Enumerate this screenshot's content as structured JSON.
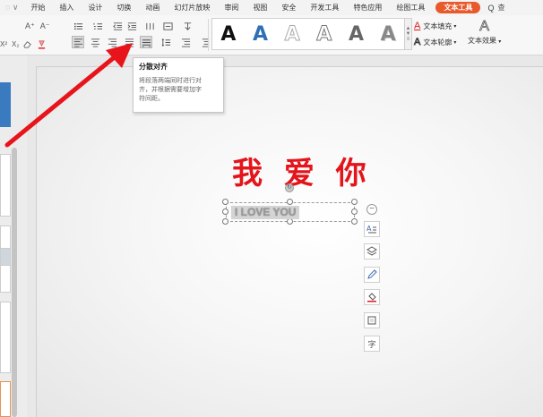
{
  "menubar": {
    "quick_access": "◌ ∨",
    "tabs": [
      "开始",
      "插入",
      "设计",
      "切换",
      "动画",
      "幻灯片放映",
      "审阅",
      "视图",
      "安全",
      "开发工具",
      "特色应用",
      "绘图工具"
    ],
    "active_tab": "文本工具",
    "search": "Q",
    "trail": "查"
  },
  "ribbon": {
    "font_size_grow": "A⁺",
    "font_size_shrink": "A⁻",
    "superscript": "X²",
    "subscript": "X₂",
    "text_fill": "文本填充",
    "text_outline": "文本轮廓",
    "text_effects": "文本效果",
    "text_effects_icon": "A",
    "wordart_styles": [
      "A",
      "A",
      "A",
      "A",
      "A",
      "A"
    ]
  },
  "tooltip": {
    "title": "分散对齐",
    "desc_line1": "将段落两端同时进行对",
    "desc_line2": "齐，并根据需要增加字",
    "desc_line3": "符间距。"
  },
  "slide": {
    "title_text": "我 爱 你",
    "textbox_text": "I LOVE YOU",
    "textbox_text_visible": "I LOVE YOU"
  },
  "side_tools": {
    "minus": "−",
    "text_label": "字"
  },
  "colors": {
    "accent_tab": "#e85a2c",
    "title_red": "#e4141b",
    "arrow_red": "#e8141b"
  }
}
